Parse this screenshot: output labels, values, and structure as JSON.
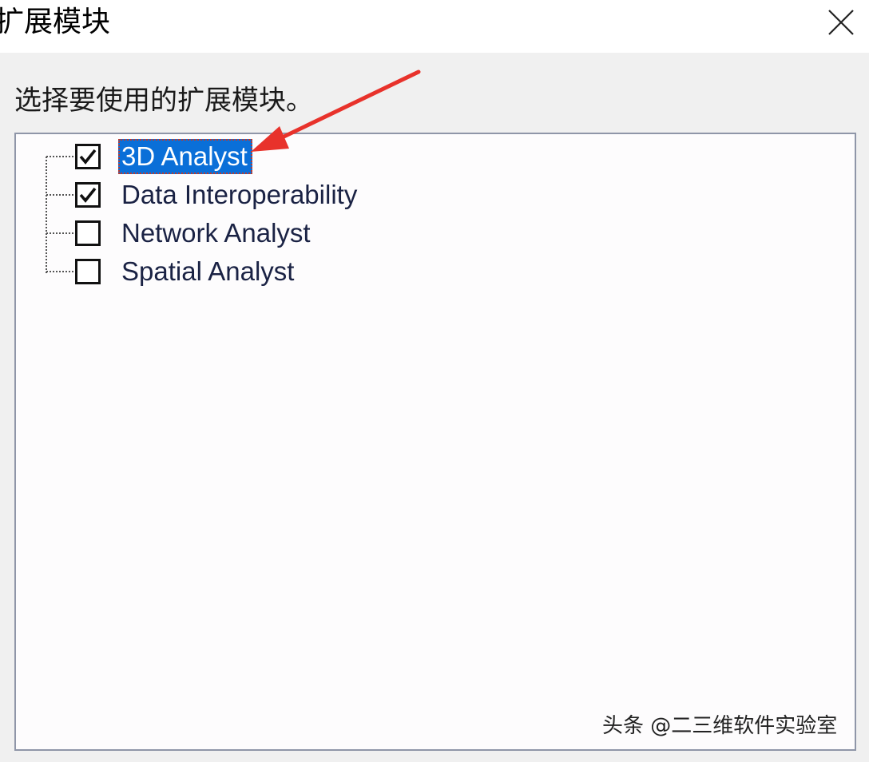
{
  "window": {
    "title": "扩展模块",
    "close_icon": "close-icon"
  },
  "prompt": "选择要使用的扩展模块。",
  "extensions": [
    {
      "label": "3D Analyst",
      "checked": true,
      "selected": true
    },
    {
      "label": "Data Interoperability",
      "checked": true,
      "selected": false
    },
    {
      "label": "Network Analyst",
      "checked": false,
      "selected": false
    },
    {
      "label": "Spatial Analyst",
      "checked": false,
      "selected": false
    }
  ],
  "annotation": {
    "arrow_color": "#e8322b"
  },
  "watermark": "头条 @二三维软件实验室",
  "colors": {
    "selection": "#0a6fd8",
    "list_border": "#8f96a8"
  }
}
